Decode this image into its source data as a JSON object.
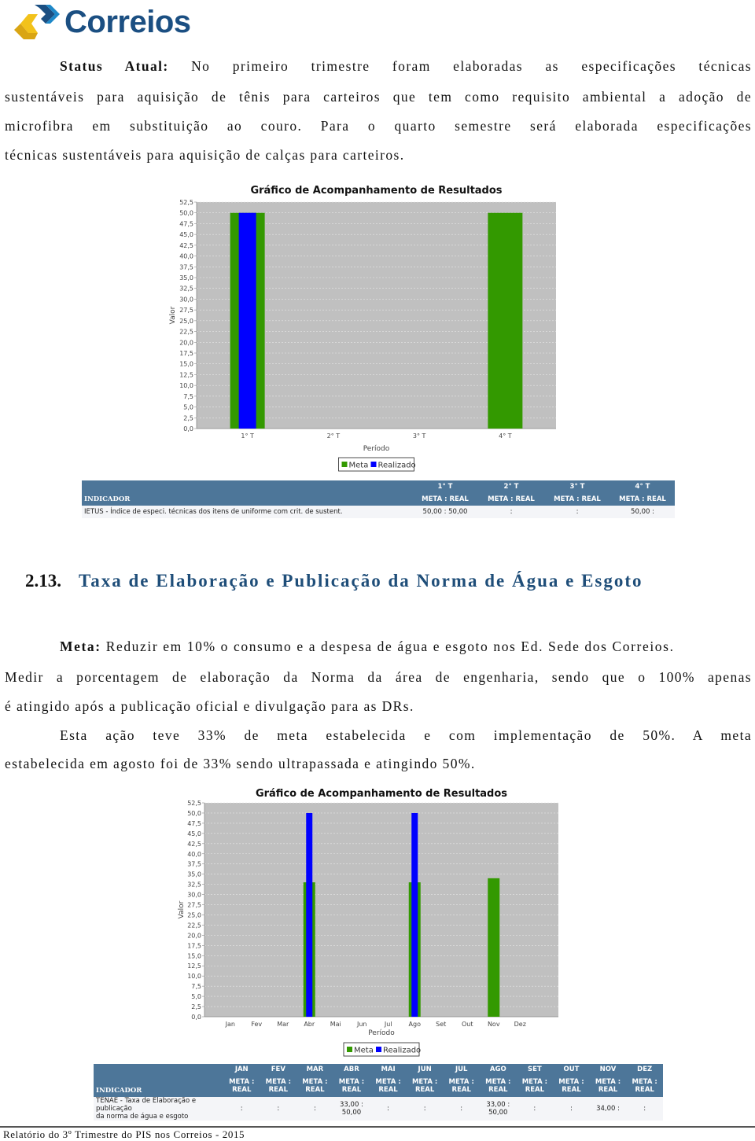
{
  "logo": {
    "brand": "Correios",
    "colors": {
      "yellow": "#f2c21b",
      "blue_dark": "#1b4f82",
      "blue_light": "#1e88c8"
    }
  },
  "status_section": {
    "label": "Status Atual:",
    "lines": [
      "No primeiro trimestre foram elaboradas as especificações técnicas",
      "sustentáveis para aquisição de tênis para carteiros que tem como requisito ambiental a adoção de",
      "microfibra em substituição ao couro. Para o quarto semestre será elaborada especificações",
      "técnicas sustentáveis para aquisição de calças para carteiros."
    ]
  },
  "chart_data": [
    {
      "type": "bar",
      "title": "Gráfico de Acompanhamento de Resultados",
      "xlabel": "Período",
      "ylabel": "Valor",
      "categories": [
        "1° T",
        "2° T",
        "3° T",
        "4° T"
      ],
      "series": [
        {
          "name": "Meta",
          "color": "#339900",
          "values": [
            50.0,
            null,
            null,
            50.0
          ]
        },
        {
          "name": "Realizado",
          "color": "#0000ff",
          "values": [
            50.0,
            null,
            null,
            null
          ]
        }
      ],
      "ylim": [
        0,
        52.5
      ],
      "yticks": [
        "0,0",
        "2,5",
        "5,0",
        "7,5",
        "10,0",
        "12,5",
        "15,0",
        "17,5",
        "20,0",
        "22,5",
        "25,0",
        "27,5",
        "30,0",
        "32,5",
        "35,0",
        "37,5",
        "40,0",
        "42,5",
        "45,0",
        "47,5",
        "50,0",
        "52,5"
      ],
      "grid": true,
      "background": "#c0c0c0",
      "legend": "bottom-center"
    },
    {
      "type": "bar",
      "title": "Gráfico de Acompanhamento de Resultados",
      "xlabel": "Período",
      "ylabel": "Valor",
      "categories": [
        "Jan",
        "Fev",
        "Mar",
        "Abr",
        "Mai",
        "Jun",
        "Jul",
        "Ago",
        "Set",
        "Out",
        "Nov",
        "Dez"
      ],
      "series": [
        {
          "name": "Meta",
          "color": "#339900",
          "values": [
            null,
            null,
            null,
            33.0,
            null,
            null,
            null,
            33.0,
            null,
            null,
            34.0,
            null
          ]
        },
        {
          "name": "Realizado",
          "color": "#0000ff",
          "values": [
            null,
            null,
            null,
            50.0,
            null,
            null,
            null,
            50.0,
            null,
            null,
            null,
            null
          ]
        }
      ],
      "ylim": [
        0,
        52.5
      ],
      "yticks": [
        "0,0",
        "2,5",
        "5,0",
        "7,5",
        "10,0",
        "12,5",
        "15,0",
        "17,5",
        "20,0",
        "22,5",
        "25,0",
        "27,5",
        "30,0",
        "32,5",
        "35,0",
        "37,5",
        "40,0",
        "42,5",
        "45,0",
        "47,5",
        "50,0",
        "52,5"
      ],
      "grid": true,
      "background": "#c0c0c0",
      "legend": "bottom-center"
    }
  ],
  "table1": {
    "indicator_header": "INDICADOR",
    "columns": [
      {
        "period": "1° T",
        "sub": "META : REAL"
      },
      {
        "period": "2° T",
        "sub": "META : REAL"
      },
      {
        "period": "3° T",
        "sub": "META : REAL"
      },
      {
        "period": "4° T",
        "sub": "META : REAL"
      }
    ],
    "row": {
      "indicator": "IETUS - Índice de especi. técnicas dos itens de uniforme com crit. de sustent.",
      "values": [
        "50,00 : 50,00",
        ":",
        ":",
        "50,00 :"
      ]
    }
  },
  "section_213": {
    "number": "2.13.",
    "title": "Taxa de Elaboração e Publicação da Norma de Água e Esgoto",
    "meta_label": "Meta:",
    "meta_text": "Reduzir em 10% o consumo e a despesa de água e esgoto nos Ed. Sede dos Correios.",
    "lines": [
      "Medir a porcentagem de elaboração da Norma da área de engenharia, sendo que o 100% apenas",
      "é atingido após a publicação oficial e divulgação para as DRs.",
      "Esta ação teve 33% de meta estabelecida e com implementação de 50%. A meta",
      "estabelecida em agosto foi de 33% sendo ultrapassada e atingindo 50%."
    ]
  },
  "table2": {
    "indicator_header": "INDICADOR",
    "columns": [
      {
        "period": "JAN",
        "sub1": "META :",
        "sub2": "REAL"
      },
      {
        "period": "FEV",
        "sub1": "META :",
        "sub2": "REAL"
      },
      {
        "period": "MAR",
        "sub1": "META :",
        "sub2": "REAL"
      },
      {
        "period": "ABR",
        "sub1": "META :",
        "sub2": "REAL"
      },
      {
        "period": "MAI",
        "sub1": "META :",
        "sub2": "REAL"
      },
      {
        "period": "JUN",
        "sub1": "META :",
        "sub2": "REAL"
      },
      {
        "period": "JUL",
        "sub1": "META :",
        "sub2": "REAL"
      },
      {
        "period": "AGO",
        "sub1": "META :",
        "sub2": "REAL"
      },
      {
        "period": "SET",
        "sub1": "META :",
        "sub2": "REAL"
      },
      {
        "period": "OUT",
        "sub1": "META :",
        "sub2": "REAL"
      },
      {
        "period": "NOV",
        "sub1": "META :",
        "sub2": "REAL"
      },
      {
        "period": "DEZ",
        "sub1": "META :",
        "sub2": "REAL"
      }
    ],
    "row": {
      "indicator_line1": "TENAE - Taxa de Elaboração e publicação",
      "indicator_line2": "da norma de água e esgoto",
      "values": [
        [
          ":",
          ""
        ],
        [
          ":",
          ""
        ],
        [
          ":",
          ""
        ],
        [
          "33,00 :",
          "50,00"
        ],
        [
          ":",
          ""
        ],
        [
          ":",
          ""
        ],
        [
          ":",
          ""
        ],
        [
          "33,00 :",
          "50,00"
        ],
        [
          ":",
          ""
        ],
        [
          ":",
          ""
        ],
        [
          "34,00 :",
          ""
        ],
        [
          ":",
          ""
        ]
      ]
    }
  },
  "footer": {
    "text": "Relatório do 3º Trimestre do PIS nos Correios - 2015"
  }
}
